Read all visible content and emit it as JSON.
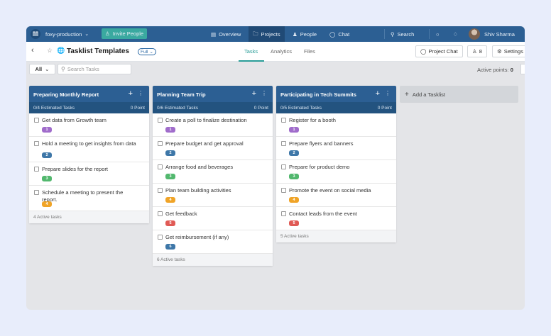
{
  "topnav": {
    "org": "foxy-production",
    "invite": "Invite People",
    "overview": "Overview",
    "projects": "Projects",
    "people": "People",
    "chat": "Chat",
    "search": "Search",
    "user": "Shiv Sharma"
  },
  "header": {
    "title": "Tasklist Templates",
    "access_badge": "Full",
    "tabs": [
      "Tasks",
      "Analytics",
      "Files"
    ],
    "active_tab": "Tasks",
    "project_chat": "Project Chat",
    "members_count": "8",
    "settings": "Settings"
  },
  "toolbar": {
    "filter": "All",
    "search_placeholder": "Search Tasks",
    "points_label": "Active points:",
    "points_value": "0"
  },
  "colors": {
    "nav": "#2c5f93",
    "accent": "#2a9d98",
    "pill_1": "#a06ccb",
    "pill_2": "#3e77a8",
    "pill_3": "#52b86e",
    "pill_4": "#f0a427",
    "pill_5": "#e05a55",
    "pill_6": "#3e77a8"
  },
  "lists": [
    {
      "name": "Preparing Monthly Report",
      "estimated": "0/4 Estimated Tasks",
      "points": "0 Point",
      "tasks": [
        {
          "name": "Get data from Growth team",
          "num": "1"
        },
        {
          "name": "Hold a meeting to get insights from data",
          "num": "2"
        },
        {
          "name": "Prepare slides for the report",
          "num": "3"
        },
        {
          "name": "Schedule a meeting to present the report.",
          "num": "4"
        }
      ],
      "footer": "4 Active tasks"
    },
    {
      "name": "Planning Team Trip",
      "estimated": "0/6 Estimated Tasks",
      "points": "0 Point",
      "tasks": [
        {
          "name": "Create a poll to finalize destination",
          "num": "1"
        },
        {
          "name": "Prepare budget and get approval",
          "num": "2"
        },
        {
          "name": "Arrange food and beverages",
          "num": "3"
        },
        {
          "name": "Plan team building activities",
          "num": "4"
        },
        {
          "name": "Get feedback",
          "num": "5"
        },
        {
          "name": "Get reimbursement (if any)",
          "num": "6"
        }
      ],
      "footer": "6 Active tasks"
    },
    {
      "name": "Participating in Tech Summits",
      "estimated": "0/5 Estimated Tasks",
      "points": "0 Point",
      "tasks": [
        {
          "name": "Register for a booth",
          "num": "1"
        },
        {
          "name": "Prepare flyers and banners",
          "num": "2"
        },
        {
          "name": "Prepare for product demo",
          "num": "3"
        },
        {
          "name": "Promote the event on social media",
          "num": "4"
        },
        {
          "name": "Contact leads from the event",
          "num": "5"
        }
      ],
      "footer": "5 Active tasks"
    }
  ],
  "add_tasklist": "Add a Tasklist"
}
